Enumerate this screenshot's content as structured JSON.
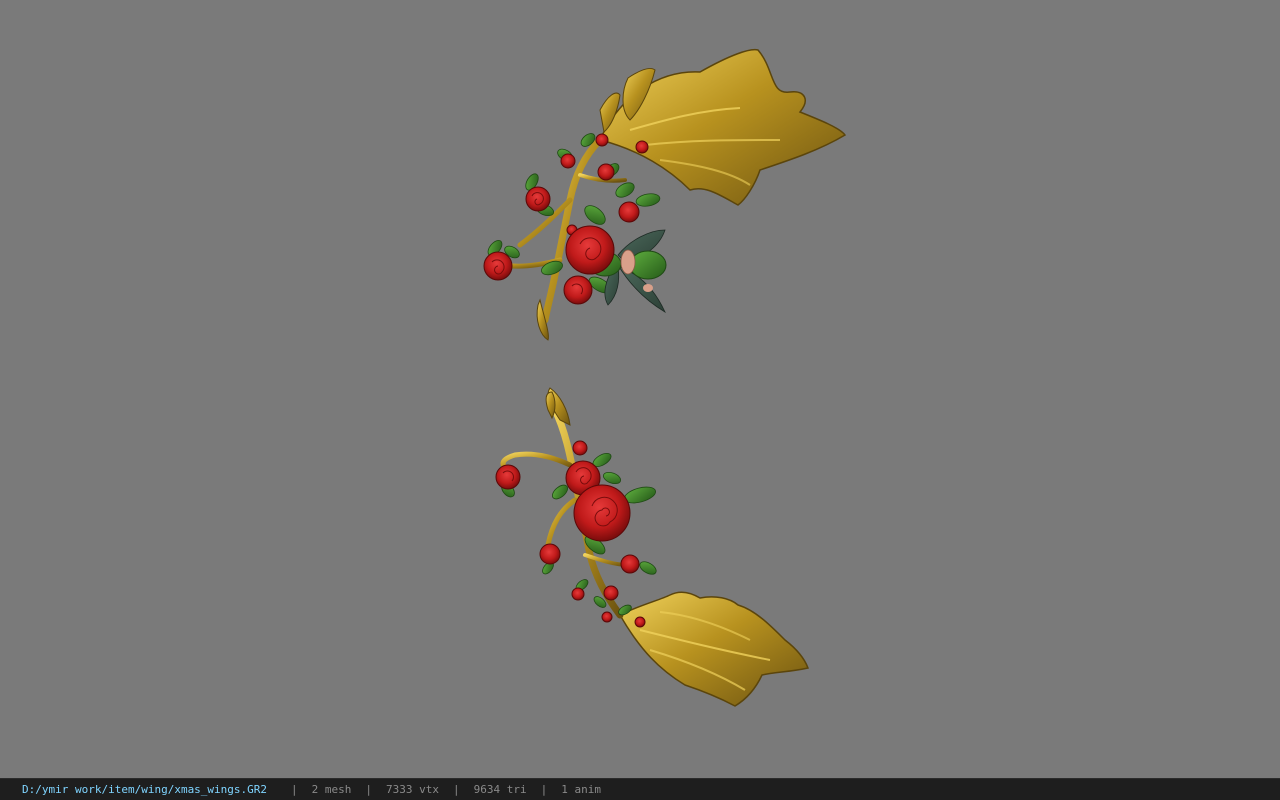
{
  "viewport": {
    "model": "xmas_wings",
    "background": "#7a7a7a",
    "colors": {
      "gold": "#b8921f",
      "gold_highlight": "#e2c34a",
      "gold_shadow": "#6b5210",
      "rose": "#c01a1a",
      "rose_dark": "#7a0c0c",
      "leaf": "#3f8a2c",
      "leaf_dark": "#255a18"
    }
  },
  "status_bar": {
    "file_path": "D:/ymir work/item/wing/xmas_wings.GR2",
    "separator": "|",
    "mesh_count": "2 mesh",
    "vertex_count": "7333 vtx",
    "triangle_count": "9634 tri",
    "anim_count": "1 anim",
    "path_color": "#7fd4ff",
    "text_color": "#8a8a8a",
    "background": "#1e1e1e"
  }
}
